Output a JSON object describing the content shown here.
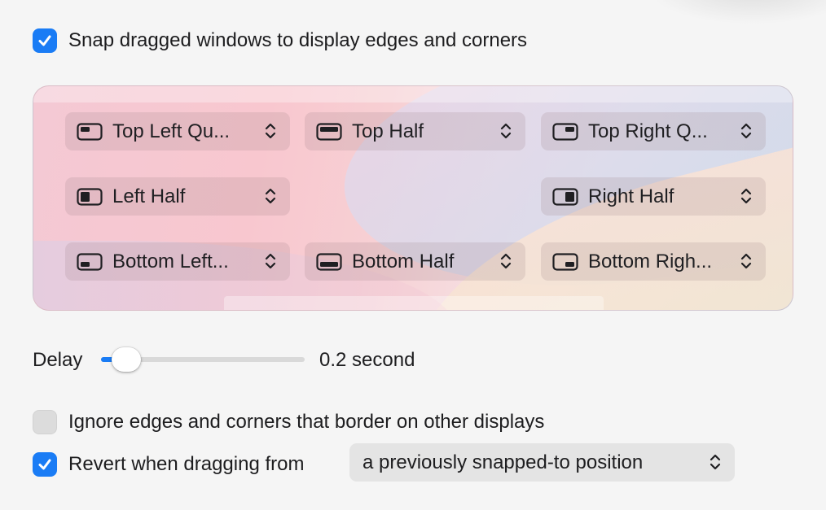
{
  "snap_checkbox": {
    "label": "Snap dragged windows to display edges and corners",
    "checked": true
  },
  "positions": [
    {
      "label": "Top Left Qu...",
      "icon": "window-top-left-icon"
    },
    {
      "label": "Top Half",
      "icon": "window-top-half-icon"
    },
    {
      "label": "Top Right Q...",
      "icon": "window-top-right-icon"
    },
    {
      "label": "Left Half",
      "icon": "window-left-half-icon"
    },
    {
      "label": "Right Half",
      "icon": "window-right-half-icon"
    },
    {
      "label": "Bottom Left...",
      "icon": "window-bottom-left-icon"
    },
    {
      "label": "Bottom Half",
      "icon": "window-bottom-half-icon"
    },
    {
      "label": "Bottom Righ...",
      "icon": "window-bottom-right-icon"
    }
  ],
  "delay": {
    "label": "Delay",
    "value_text": "0.2 second",
    "value_fraction": 0.1
  },
  "ignore_checkbox": {
    "label": "Ignore edges and corners that border on other displays",
    "checked": false
  },
  "revert_checkbox": {
    "label": "Revert when dragging from",
    "checked": true
  },
  "revert_select": {
    "value": "a previously snapped-to position"
  },
  "colors": {
    "accent": "#1a7cf5",
    "text": "#1d1d1f",
    "background": "#f5f5f5"
  }
}
